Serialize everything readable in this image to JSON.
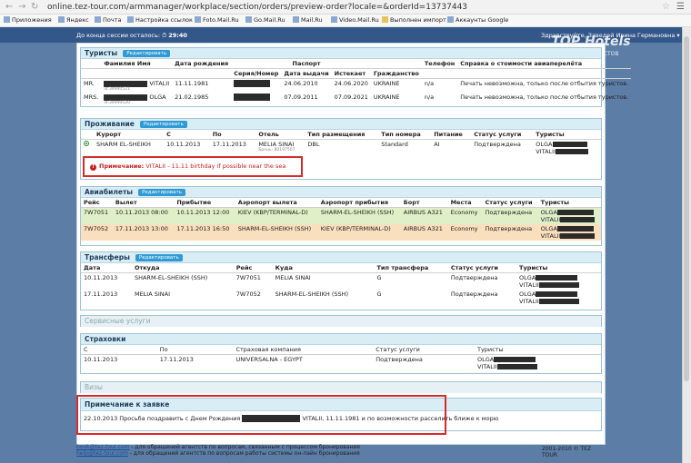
{
  "browser": {
    "url": "online.tez-tour.com/armmanager/workplace/section/orders/preview-order?locale=&orderId=13737443",
    "menu_icon": "☰",
    "bookmarks": [
      "Приложения",
      "Яндекс",
      "Почта",
      "Настройка ссылок",
      "Foto.Mail.Ru",
      "Go.Mail.Ru",
      "Mail.Ru",
      "Video.Mail.Ru",
      "Выполнен импорт",
      "Аккаунты Google"
    ]
  },
  "session": {
    "label": "До конца сессии осталось:",
    "time": "29:40"
  },
  "greeting": "Здравствуйте, Заведей Ирина Германовна ▾",
  "logo": {
    "title": "TOP Hotels",
    "subtitle": "ОТЗЫВЫ ТУРИСТОВ"
  },
  "edit_label": "Редактировать",
  "tourists": {
    "title": "Туристы",
    "headers": [
      "Фамилия Имя",
      "Дата рождения",
      "Серия/Номер",
      "Дата выдачи",
      "Истекает",
      "Гражданство",
      "Телефон",
      "Справка о стоимости авиаперелёта"
    ],
    "passport_header": "Паспорт",
    "rows": [
      {
        "title": "MR.",
        "name": "VITALII",
        "id": "id:34940521",
        "dob": "11.11.1981",
        "issued": "24.06.2010",
        "expires": "24.06.2020",
        "citizen": "UKRAINE",
        "phone": "n/a",
        "note": "Печать невозможна, только после отбытия туристов."
      },
      {
        "title": "MRS.",
        "name": "OLGA",
        "id": "id:34940520",
        "dob": "21.02.1985",
        "issued": "07.09.2011",
        "expires": "07.09.2021",
        "citizen": "UKRAINE",
        "phone": "n/a",
        "note": "Печать невозможна, только после отбытия туристов."
      }
    ]
  },
  "accommodation": {
    "title": "Проживание",
    "headers": [
      "Курорт",
      "С",
      "По",
      "Отель",
      "Тип размещения",
      "Тип номера",
      "Питание",
      "Статус услуги",
      "Туристы"
    ],
    "row": {
      "resort": "SHARM EL-SHEIKH",
      "from": "10.11.2013",
      "to": "17.11.2013",
      "hotel": "MELIA SINAI",
      "hotel_sub": "Бронь: 80197507",
      "room": "DBL",
      "room_type": "Standard",
      "meal": "AI",
      "status": "Подтверждена",
      "t1": "OLGA",
      "t2": "VITALII"
    },
    "note_label": "Примечание:",
    "note_text": "VITALII - 11.11 birthday if possible near the sea"
  },
  "flights": {
    "title": "Авиабилеты",
    "headers": [
      "Рейс",
      "Вылет",
      "Прибытие",
      "Аэропорт вылета",
      "Аэропорт прибытия",
      "Борт",
      "Места",
      "Статус услуги",
      "Туристы"
    ],
    "rows": [
      {
        "flight": "7W7051",
        "dep": "10.11.2013 08:00",
        "arr": "10.11.2013 12:00",
        "from": "KIEV (KBP/TERMINAL-D)",
        "to": "SHARM-EL-SHEIKH (SSH)",
        "plane": "AIRBUS A321",
        "class": "Economy",
        "status": "Подтверждена",
        "t1": "OLGA",
        "t2": "VITALII"
      },
      {
        "flight": "7W7052",
        "dep": "17.11.2013 13:00",
        "arr": "17.11.2013 16:50",
        "from": "SHARM-EL-SHEIKH (SSH)",
        "to": "KIEV (KBP/TERMINAL-D)",
        "plane": "AIRBUS A321",
        "class": "Economy",
        "status": "Подтверждена",
        "t1": "OLGA",
        "t2": "VITALII"
      }
    ]
  },
  "transfers": {
    "title": "Трансферы",
    "headers": [
      "Дата",
      "Откуда",
      "Рейс",
      "Куда",
      "Тип трансфера",
      "Статус услуги",
      "Туристы"
    ],
    "rows": [
      {
        "date": "10.11.2013",
        "from": "SHARM-EL-SHEIKH (SSH)",
        "flight": "7W7051",
        "to": "MELIA SINAI",
        "type": "G",
        "status": "Подтверждена",
        "t1": "OLGA",
        "t2": "VITALII"
      },
      {
        "date": "17.11.2013",
        "from": "MELIA SINAI",
        "flight": "7W7052",
        "to": "SHARM-EL-SHEIKH (SSH)",
        "type": "G",
        "status": "Подтверждена",
        "t1": "OLGA",
        "t2": "VITALII"
      }
    ]
  },
  "extra_services": {
    "title": "Сервисные услуги"
  },
  "insurance": {
    "title": "Страховки",
    "headers": [
      "С",
      "По",
      "Страховая компания",
      "Статус услуги",
      "Туристы"
    ],
    "row": {
      "from": "10.11.2013",
      "to": "17.11.2013",
      "company": "UNIVERSALNA - EGYPT",
      "status": "Подтверждена",
      "t1": "OLGA",
      "t2": "VITALII"
    }
  },
  "visas": {
    "title": "Визы"
  },
  "order_note": {
    "title": "Примечание к заявке",
    "text_before": "22.10.2013 Просьба поздравить с Днем Рождения",
    "text_after": "VITALII, 11.11.1981 и по возможности расселить ближе к морю"
  },
  "footer": {
    "email1": "book@tez-tour.com",
    "text1": " - для обращений агентств по вопросам, связанным с процессом бронирования",
    "email2": "help@tez-tour.com",
    "text2": " - для обращений агентств по вопросам работы системы он-лайн бронирования",
    "copyright": "2001-2010 © TEZ TOUR"
  }
}
